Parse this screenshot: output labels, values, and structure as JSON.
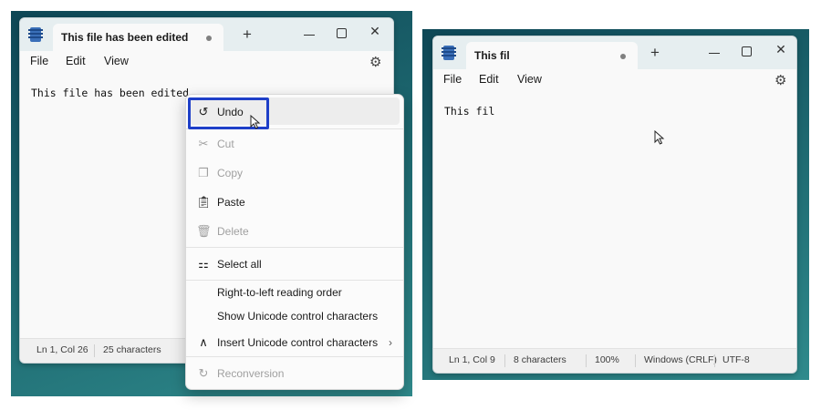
{
  "left": {
    "tab_title": "This file has been edited",
    "new_tab": "+",
    "menu": {
      "file": "File",
      "edit": "Edit",
      "view": "View"
    },
    "editor_text": "This file has been edited",
    "status": {
      "position": "Ln 1, Col 26",
      "chars": "25 characters"
    },
    "context_menu": {
      "undo": "Undo",
      "cut": "Cut",
      "copy": "Copy",
      "paste": "Paste",
      "delete": "Delete",
      "select_all": "Select all",
      "rtl": "Right-to-left reading order",
      "show_unicode": "Show Unicode control characters",
      "insert_unicode": "Insert Unicode control characters",
      "reconversion": "Reconversion"
    }
  },
  "right": {
    "tab_title": "This fil",
    "new_tab": "+",
    "menu": {
      "file": "File",
      "edit": "Edit",
      "view": "View"
    },
    "editor_text": "This fil",
    "status": {
      "position": "Ln 1, Col 9",
      "chars": "8 characters",
      "zoom": "100%",
      "line_ending": "Windows (CRLF)",
      "encoding": "UTF-8"
    }
  },
  "icons": {
    "app": "notepad-icon",
    "minimize": "minimize-icon",
    "maximize": "maximize-icon",
    "close": "close-icon",
    "settings": "gear-icon",
    "undo": "undo-icon",
    "cut": "scissors-icon",
    "copy": "copy-icon",
    "paste": "clipboard-icon",
    "delete": "trash-icon",
    "select_all": "select-all-icon",
    "insert_unicode": "caret-icon",
    "reconversion": "reconversion-icon"
  },
  "colors": {
    "highlight_border": "#1e3fc8",
    "desktop": "#1a5a66"
  }
}
